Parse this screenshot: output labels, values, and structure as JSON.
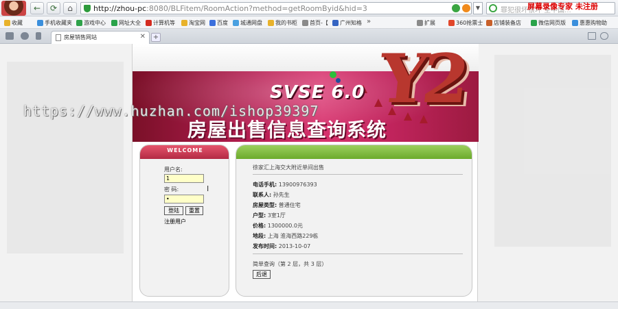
{
  "browser": {
    "url_host": "http://zhou-pc",
    "url_rest": ":8080/BLFitem/RoomAction?method=getRoomByid&hid=3",
    "search_placeholder": "罪犯很坏很坏 全中国...",
    "recorder_watermark": "屏幕录像专家  未注册",
    "tab_title": "房屋销售网站",
    "bookmarks": [
      "收藏",
      "手机收藏夹",
      "游戏中心",
      "网址大全",
      "计算机等",
      "淘宝网",
      "百度",
      "城通网盘",
      "我的书柜",
      "首页-【",
      "广州知格",
      "扩展",
      "360抢票士",
      "店铺装备店",
      "微信网页版",
      "惠惠购物助"
    ],
    "bookmark_colors": [
      "#e8b22b",
      "#3b8fdc",
      "#2fa24a",
      "#2aa34a",
      "#d42c20",
      "#e8b22b",
      "#3b6fdc",
      "#4aa0e0",
      "#e8b22b",
      "#8a8a8a",
      "#3564c2",
      "#8a8a8a",
      "#e2472b",
      "#c8602a",
      "#2aa34a",
      "#3b8fdc"
    ]
  },
  "banner": {
    "logo_big": "Y2",
    "logo_small": "SVSE 6.0",
    "title": "房屋出售信息查询系统"
  },
  "overlay_text": "https://www.huzhan.com/ishop39397",
  "login": {
    "header": "WELCOME",
    "username_label": "用户名:",
    "username_value": "1",
    "password_label": "密  码:",
    "password_value": "•",
    "login_button": "登陆",
    "reset_button": "重置",
    "register_link": "注册用户"
  },
  "detail": {
    "headline": "徐家汇上海交大附近单间出售",
    "phone_label": "电话手机:",
    "phone_value": "13900976393",
    "contact_label": "联系人:",
    "contact_value": "孙先生",
    "type_label": "房屋类型:",
    "type_value": "普通住宅",
    "layout_label": "户型:",
    "layout_value": "3室1厅",
    "price_label": "价格:",
    "price_value": "1300000.0元",
    "location_label": "地段:",
    "location_value": "上海  淮海西路229栋",
    "date_label": "发布时间:",
    "date_value": "2013-10-07",
    "paging": "简单查询（第 2 层，共 3 层）",
    "back_button": "后退"
  }
}
